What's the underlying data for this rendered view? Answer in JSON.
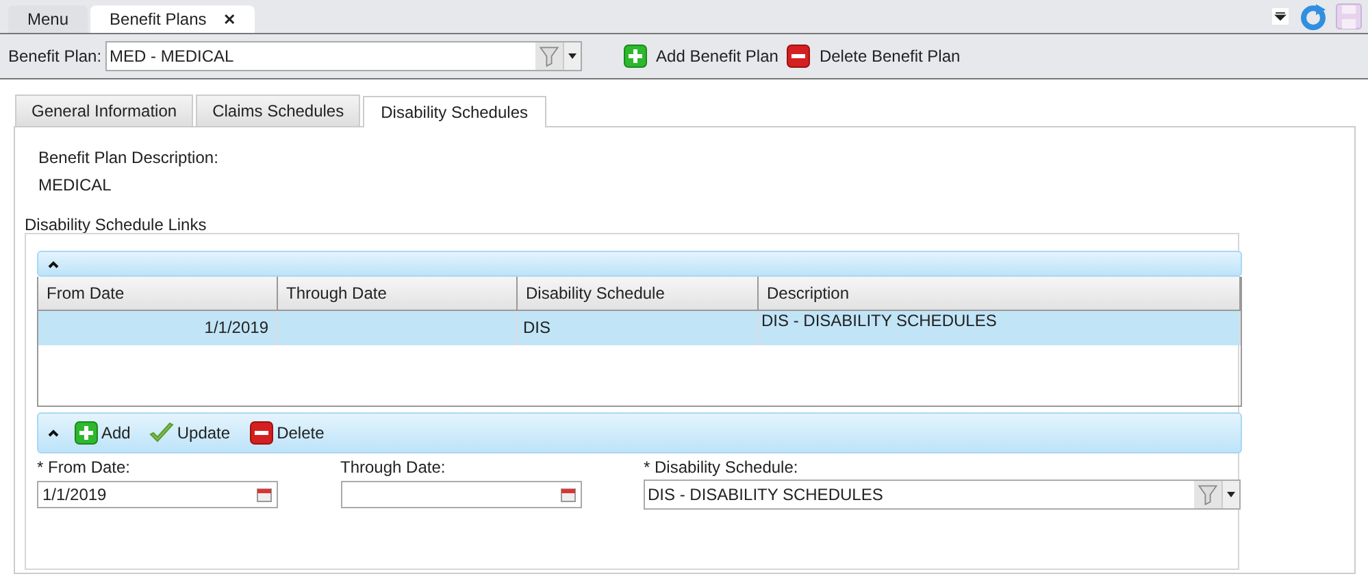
{
  "doc_tabs": [
    {
      "label": "Menu",
      "selected": false
    },
    {
      "label": "Benefit Plans",
      "selected": true,
      "close": "✕"
    }
  ],
  "toolbar": {
    "label": "Benefit Plan:",
    "value": "MED - MEDICAL",
    "buttons": [
      {
        "kind": "add",
        "label": "Add Benefit Plan"
      },
      {
        "kind": "delete",
        "label": "Delete Benefit Plan"
      }
    ]
  },
  "tabs": [
    {
      "label": "General Information",
      "selected": false
    },
    {
      "label": "Claims Schedules",
      "selected": false
    },
    {
      "label": "Disability Schedules",
      "selected": true
    }
  ],
  "description": {
    "label": "Benefit Plan Description:",
    "value": "MEDICAL"
  },
  "group": {
    "title": "Disability Schedule Links",
    "grid": {
      "columns": [
        {
          "label": "From Date",
          "kind": "date"
        },
        {
          "label": "Through Date",
          "kind": "date"
        },
        {
          "label": "Disability Schedule",
          "kind": "text"
        },
        {
          "label": "Description",
          "kind": "text"
        }
      ],
      "rows": [
        {
          "selected": true,
          "cells": [
            "1/1/2019",
            "",
            "DIS",
            "DIS - DISABILITY SCHEDULES"
          ]
        }
      ]
    },
    "actions": [
      {
        "kind": "add",
        "label": "Add"
      },
      {
        "kind": "update",
        "label": "Update"
      },
      {
        "kind": "delete",
        "label": "Delete"
      }
    ],
    "fields": [
      {
        "kind": "date",
        "label": "* From Date:",
        "value": "1/1/2019"
      },
      {
        "kind": "date",
        "label": "Through Date:"
      },
      {
        "kind": "combo",
        "label": "* Disability Schedule:",
        "value": "DIS - DISABILITY SCHEDULES"
      }
    ]
  }
}
